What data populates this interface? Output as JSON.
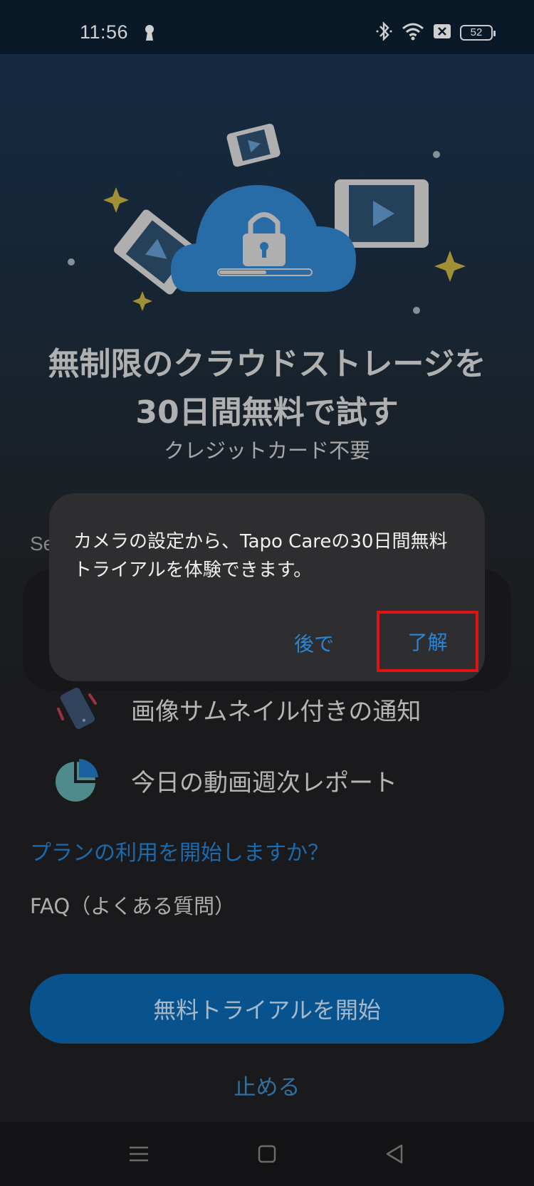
{
  "status_bar": {
    "time": "11:56",
    "battery": "52"
  },
  "headline": {
    "line1": "無制限のクラウドストレージを",
    "line2": "30日間無料で試す"
  },
  "subtext": "クレジットカード不要",
  "section_peek": "Se",
  "features": [
    {
      "icon": "phone-notification-icon",
      "label": "画像サムネイル付きの通知"
    },
    {
      "icon": "pie-chart-icon",
      "label": "今日の動画週次レポート"
    }
  ],
  "links": {
    "plan": "プランの利用を開始しますか？",
    "faq": "FAQ（よくある質問）",
    "stop": "止める"
  },
  "start_button": "無料トライアルを開始",
  "dialog": {
    "message": "カメラの設定から、Tapo Careの30日間無料トライアルを体験できます。",
    "later": "後で",
    "ok": "了解"
  },
  "colors": {
    "accent": "#0a5fa2",
    "link": "#1f79c4",
    "highlight_box": "#e11212"
  }
}
